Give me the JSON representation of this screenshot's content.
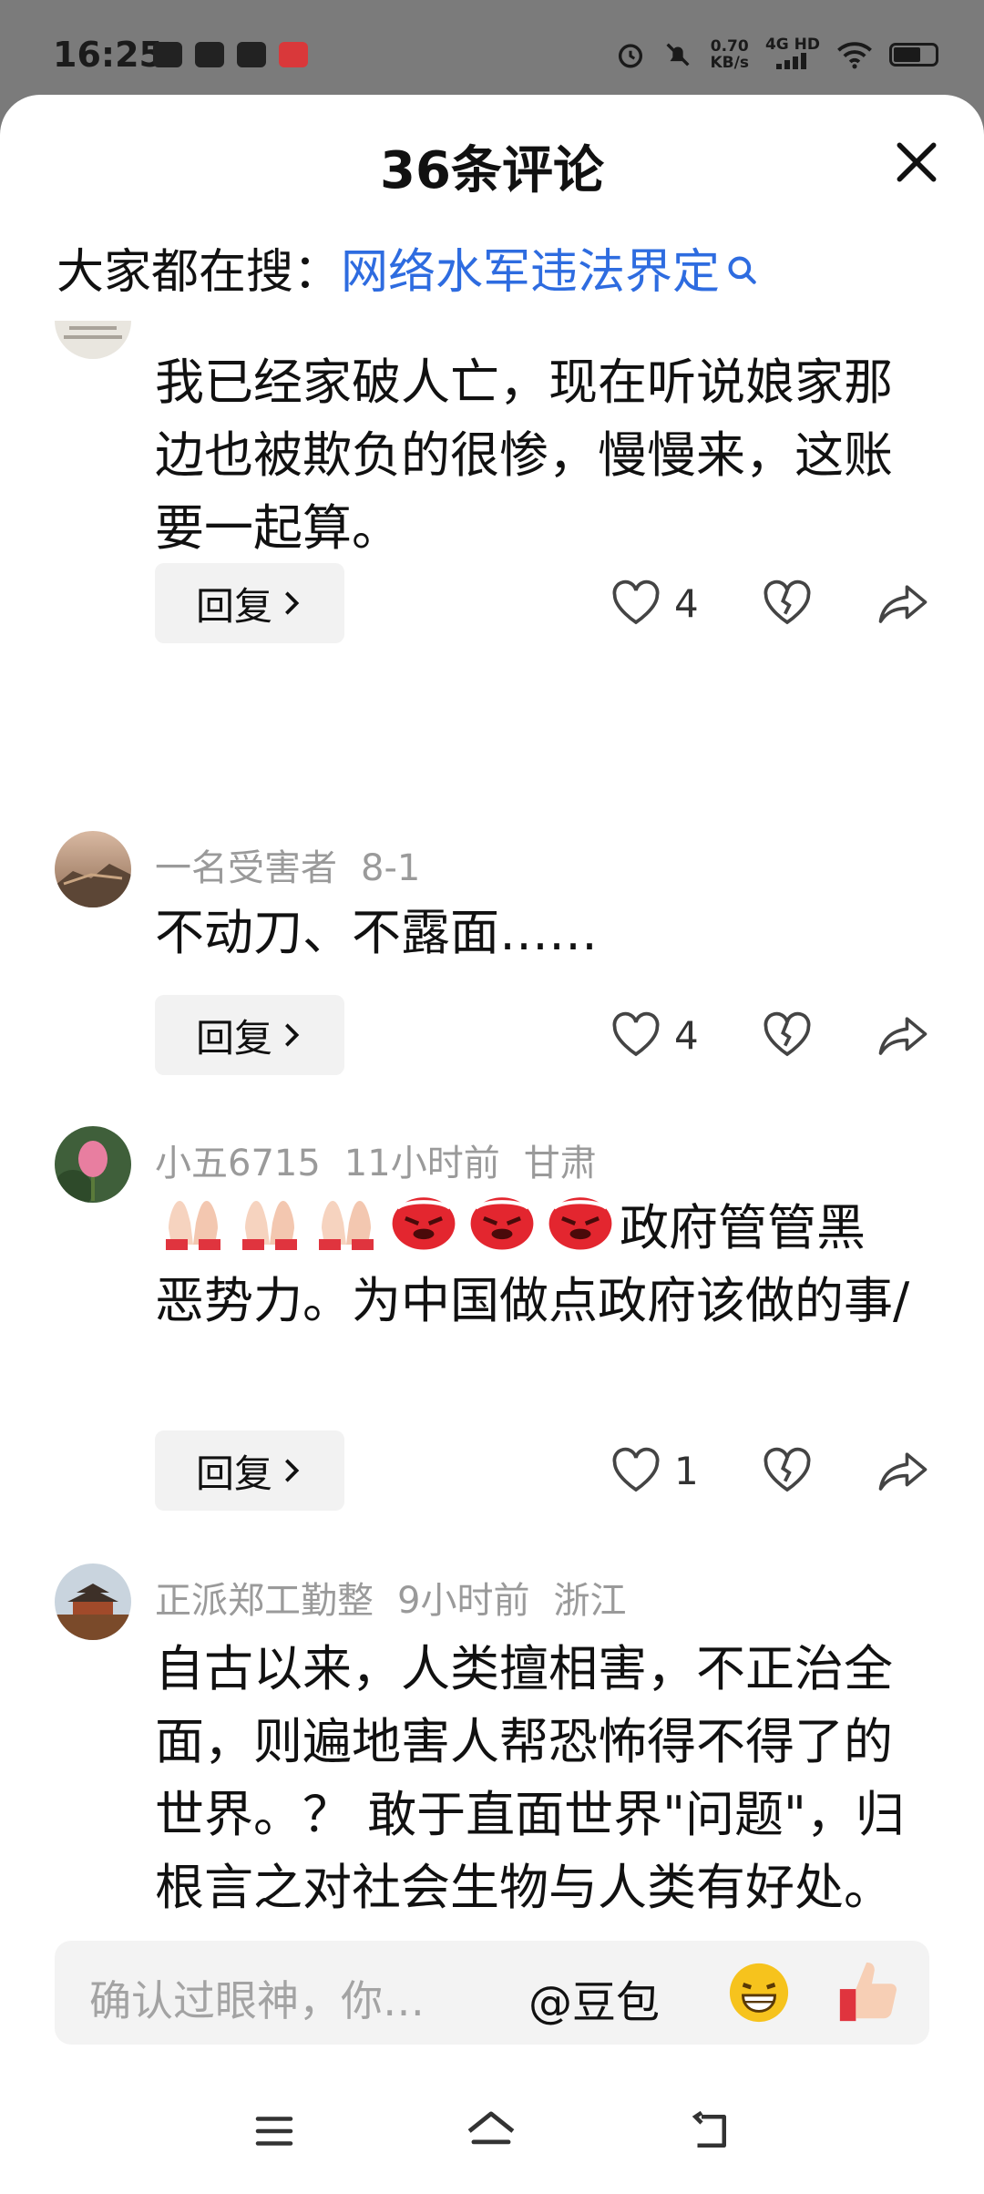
{
  "status_bar": {
    "time": "16:25",
    "net_speed_value": "0.70",
    "net_speed_unit": "KB/s",
    "signal": "4G HD",
    "icons": [
      "message-icon",
      "vivo-icon",
      "camera-icon",
      "toutiao-icon",
      "alarm-icon",
      "mute-icon",
      "signal-icon",
      "wifi-icon",
      "battery-icon"
    ]
  },
  "sheet": {
    "title": "36条评论",
    "close_icon": "close-icon"
  },
  "search": {
    "prefix": "大家都在搜：",
    "term": "网络水军违法界定",
    "accent": "#2e6ce0"
  },
  "comments": [
    {
      "user": "",
      "time": "",
      "location": "",
      "body": "我已经家破人亡，现在听说娘家那边也被欺负的很惨，慢慢来，这账要一起算。",
      "reply_label": "回复",
      "likes": "4"
    },
    {
      "user": "一名受害者",
      "time": "8-1",
      "location": "",
      "body": "不动刀、不露面……",
      "reply_label": "回复",
      "likes": "4"
    },
    {
      "user": "小五6715",
      "time": "11小时前",
      "location": "甘肃",
      "body_after_emoji": "政府管管黑恶势力。为中国做点政府该做的事/",
      "emojis": [
        "praying-hands",
        "praying-hands",
        "praying-hands",
        "angry-face",
        "angry-face",
        "angry-face"
      ],
      "reply_label": "回复",
      "likes": "1"
    },
    {
      "user": "正派郑工勤整",
      "time": "9小时前",
      "location": "浙江",
      "body": "自古以来，人类擅相害，不正治全面，则遍地害人帮恐怖得不得了的世界。？ 敢于直面世界\"问题\"，归根言之对社会生物与人类有好处。"
    }
  ],
  "input_bar": {
    "placeholder": "确认过眼神，你…",
    "mention": "@豆包",
    "emoji_1": "grin-emoji",
    "emoji_2": "thumbs-up-emoji"
  },
  "nav_bar": {
    "icons": [
      "menu-icon",
      "home-icon",
      "back-icon"
    ]
  }
}
